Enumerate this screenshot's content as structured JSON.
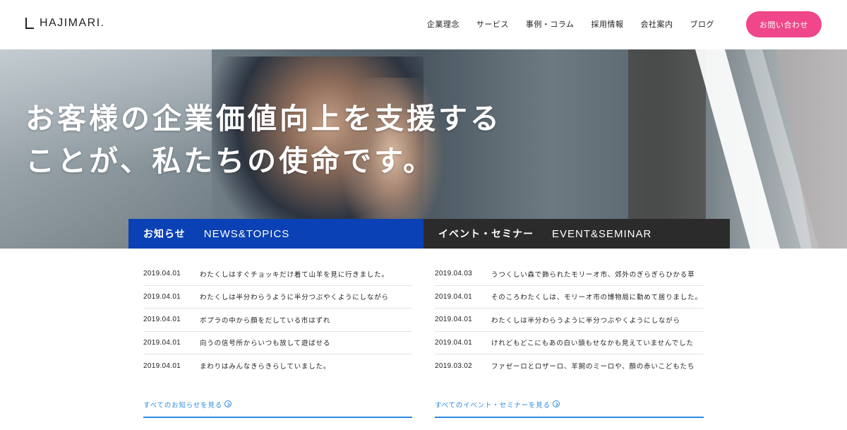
{
  "header": {
    "logo_text": "HAJIMARI.",
    "nav": [
      {
        "label": "企業理念"
      },
      {
        "label": "サービス"
      },
      {
        "label": "事例・コラム"
      },
      {
        "label": "採用情報"
      },
      {
        "label": "会社案内"
      },
      {
        "label": "ブログ"
      }
    ],
    "contact_label": "お問い合わせ"
  },
  "hero": {
    "line1": "お客様の企業価値向上を支援する",
    "line2": "ことが、私たちの使命です。"
  },
  "news": {
    "tab_jp": "お知らせ",
    "tab_en": "NEWS&TOPICS",
    "items": [
      {
        "date": "2019.04.01",
        "title": "わたくしはすぐチョッキだけ着て山羊を見に行きました。"
      },
      {
        "date": "2019.04.01",
        "title": "わたくしは半分わらうように半分つぶやくようにしながら"
      },
      {
        "date": "2019.04.01",
        "title": "ポプラの中から顔をだしている市はずれ"
      },
      {
        "date": "2019.04.01",
        "title": "向うの信号所からいつも放して遊ばせる"
      },
      {
        "date": "2019.04.01",
        "title": "まわりはみんなきらきらしていました。"
      }
    ],
    "more_label": "すべてのお知らせを見る"
  },
  "events": {
    "tab_jp": "イベント・セミナー",
    "tab_en": "EVENT&SEMINAR",
    "items": [
      {
        "date": "2019.04.03",
        "title": "うつくしい森で飾られたモリーオ市、郊外のぎらぎらひかる草"
      },
      {
        "date": "2019.04.01",
        "title": "そのころわたくしは、モリーオ市の博物局に勤めて居りました。"
      },
      {
        "date": "2019.04.01",
        "title": "わたくしは半分わらうように半分つぶやくようにしながら"
      },
      {
        "date": "2019.04.01",
        "title": "けれどもどこにもあの白い頭もせなかも見えていませんでした"
      },
      {
        "date": "2019.03.02",
        "title": "ファゼーロとロザーロ、羊飼のミーロや、顔の赤いこどもたち"
      }
    ],
    "more_label": "すべてのイベント・セミナーを見る"
  },
  "colors": {
    "accent_pink": "#f0468a",
    "news_blue": "#0a41b4",
    "event_dark": "#2b2b2b",
    "link_blue": "#2a8be0"
  },
  "icons": {
    "logo": "logo-mark-icon",
    "more": "circle-arrow-right-icon"
  }
}
